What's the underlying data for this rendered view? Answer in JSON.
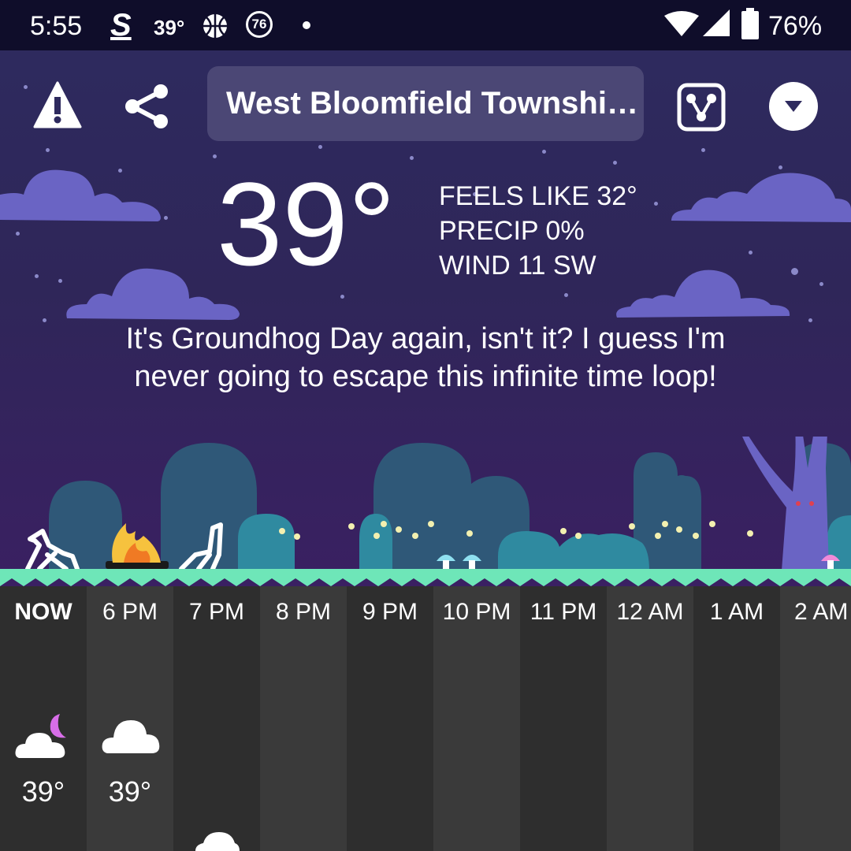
{
  "status_bar": {
    "time": "5:55",
    "app_badge_s": "S",
    "weather_temp": "39°",
    "badge_76": "76",
    "battery": "76%"
  },
  "toolbar": {
    "location": "West Bloomfield Townshi…",
    "icons": [
      "alert-icon",
      "share-icon",
      "radar-icon",
      "dropdown-icon"
    ]
  },
  "current": {
    "temperature": "39°",
    "feels_like": "FEELS LIKE 32°",
    "precip": "PRECIP 0%",
    "wind": "WIND 11 SW",
    "quote": "It's Groundhog Day again, isn't it? I guess I'm never going to escape this infinite time loop!"
  },
  "hourly": [
    {
      "label": "NOW",
      "temp": "39°",
      "icon": "cloud-moon-icon"
    },
    {
      "label": "6 PM",
      "temp": "39°",
      "icon": "cloud-icon"
    },
    {
      "label": "7 PM",
      "temp": "",
      "icon": "cloud-icon"
    },
    {
      "label": "8 PM",
      "temp": "",
      "icon": ""
    },
    {
      "label": "9 PM",
      "temp": "",
      "icon": ""
    },
    {
      "label": "10 PM",
      "temp": "",
      "icon": ""
    },
    {
      "label": "11 PM",
      "temp": "",
      "icon": ""
    },
    {
      "label": "12 AM",
      "temp": "",
      "icon": ""
    },
    {
      "label": "1 AM",
      "temp": "",
      "icon": ""
    },
    {
      "label": "2 AM",
      "temp": "",
      "icon": ""
    }
  ],
  "colors": {
    "sky_top": "#2e2a5e",
    "cloud": "#6a64c4",
    "grass": "#6ee6b8",
    "bush": "#2f6e8f",
    "hourly_dark": "#2e2e2e",
    "hourly_light": "#3a3a3a"
  }
}
